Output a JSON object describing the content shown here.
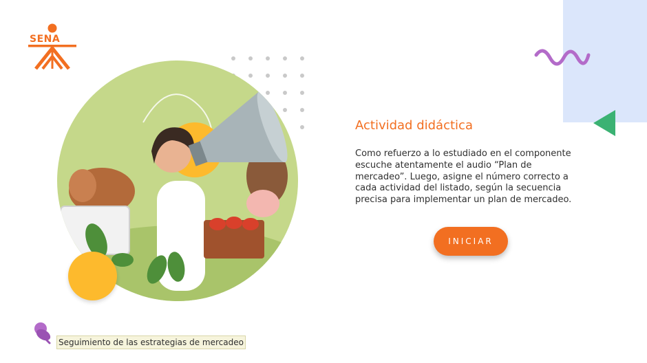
{
  "brand": {
    "logo_text": "SENA",
    "logo_color": "#f26f21"
  },
  "main": {
    "title": "Actividad didáctica",
    "description": "Como refuerzo a lo estudiado en el componente escuche atentamente el audio “Plan de mercadeo”. Luego, asigne el número correcto a cada actividad del listado, según la secuencia precisa para implementar un plan de mercadeo.",
    "start_label": "INICIAR"
  },
  "footer": {
    "breadcrumb": "Seguimiento de las estrategias de mercadeo"
  },
  "colors": {
    "accent": "#f26f21",
    "panel_blue": "#dbe6fb",
    "wave_purple": "#b36bc9",
    "triangle_green": "#3bb273",
    "yellow": "#fdba2d",
    "illustration_green": "#c5d88a"
  },
  "icons": {
    "logo": "sena-logo-icon",
    "decoration_wave": "wave-icon",
    "decoration_triangle": "triangle-icon",
    "breadcrumb": "pushpin-icon"
  }
}
